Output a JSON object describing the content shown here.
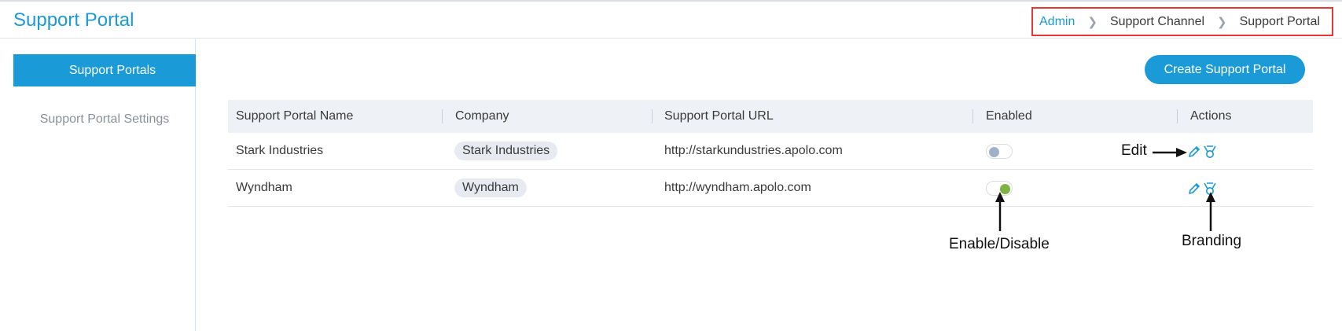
{
  "header": {
    "title": "Support Portal"
  },
  "breadcrumb": [
    "Admin",
    "Support Channel",
    "Support Portal"
  ],
  "sidebar": {
    "items": [
      {
        "label": "Support Portals",
        "active": true
      },
      {
        "label": "Support Portal Settings",
        "active": false
      }
    ]
  },
  "toolbar": {
    "create_label": "Create Support Portal"
  },
  "table": {
    "columns": [
      "Support Portal Name",
      "Company",
      "Support Portal URL",
      "Enabled",
      "Actions"
    ],
    "rows": [
      {
        "name": "Stark Industries",
        "company": "Stark Industries",
        "url": "http://starkundustries.apolo.com",
        "enabled": false
      },
      {
        "name": "Wyndham",
        "company": "Wyndham",
        "url": "http://wyndham.apolo.com",
        "enabled": true
      }
    ]
  },
  "annotations": {
    "edit": "Edit",
    "toggle": "Enable/Disable",
    "branding": "Branding"
  },
  "colors": {
    "accent": "#1a9ad6",
    "highlight_border": "#e53935",
    "toggle_on": "#7cb342",
    "toggle_off": "#9fb0c8"
  }
}
